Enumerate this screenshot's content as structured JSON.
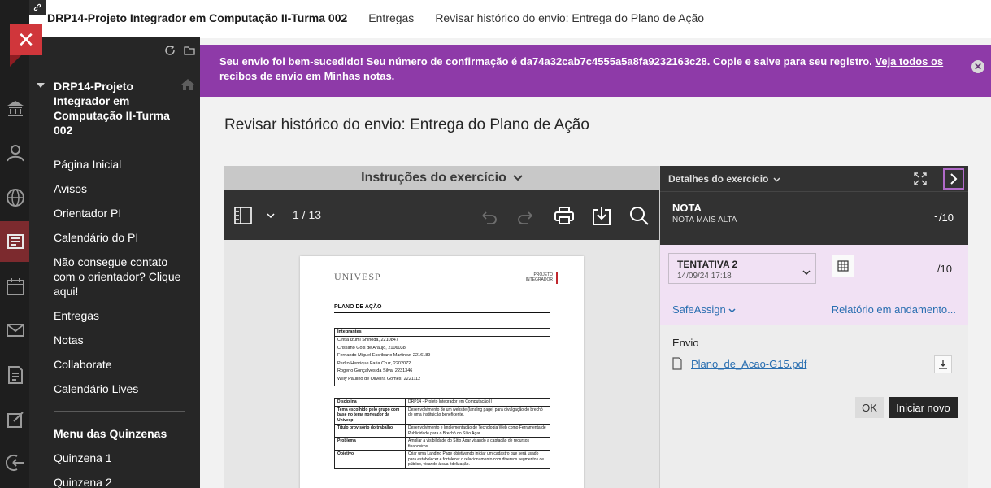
{
  "topbar": {
    "link_icon": "link-icon",
    "crumbs": [
      "DRP14-Projeto Integrador em Computação II-Turma 002",
      "Entregas",
      "Revisar histórico do envio: Entrega do Plano de Ação"
    ]
  },
  "menu": {
    "close_glyph": "✕",
    "course_title": "DRP14-Projeto Integrador em Computação II-Turma 002",
    "items": [
      "Página Inicial",
      "Avisos",
      "Orientador PI",
      "Calendário do PI",
      "Não consegue contato com o orientador? Clique aqui!",
      "Entregas",
      "Notas",
      "Collaborate",
      "Calendário Lives"
    ],
    "submenu_title": "Menu das Quinzenas",
    "submenu_items": [
      "Quinzena 1",
      "Quinzena 2"
    ]
  },
  "banner": {
    "message": "Seu envio foi bem-sucedido! Seu número de confirmação é da74a32cab7c4555a5a8fa9232163c28. Copie e salve para seu registro.",
    "link": "Veja todos os recibos de envio em Minhas notas.",
    "close_glyph": "✕"
  },
  "page": {
    "title": "Revisar histórico do envio: Entrega do Plano de Ação"
  },
  "viewer": {
    "instructions_label": "Instruções do exercício",
    "page_indicator": "1 / 13",
    "doc": {
      "logo": "UNIVESP",
      "tag_line1": "PROJETO",
      "tag_line2": "INTEGRADOR",
      "heading": "PLANO DE AÇÃO",
      "members_header": "Integrantes",
      "members": [
        "Cintia Izumi Shinoda, 2210847",
        "Cristiano Gois de Araujo, 2106038",
        "Fernando Miguel Escribano Martinez, 2216189",
        "Pedro Henrique Faria Cruz, 2202072",
        "Rogerio Gonçalves da Silva, 2231346",
        "Willy Paulino de Oliveira Gomes, 2221112"
      ],
      "rows": [
        {
          "k": "Disciplina",
          "v": "DRP14 - Projeto Integrador em Computação II"
        },
        {
          "k": "Tema escolhido pelo grupo com base no tema norteador da Univesp",
          "v": "Desenvolvimento de um website (landing page) para divulgação do brechó de uma instituição beneficente."
        },
        {
          "k": "Título provisório do trabalho",
          "v": "Desenvolvimento e Implementação de Tecnologia Web como Ferramenta de Publicidade para o Brechó do Sítio Agar"
        },
        {
          "k": "Problema",
          "v": "Ampliar a visibilidade do Sítio Agar visando a captação de recursos financeiros"
        },
        {
          "k": "Objetivo",
          "v": "Criar uma Landing Page objetivando iniciar um cadastro que será usado para estabelecer e fortalecer o relacionamento com diversos segmentos de público, visando à sua fidelização."
        }
      ]
    }
  },
  "panel": {
    "header": "Detalhes do exercício",
    "grade_label": "NOTA",
    "grade_sublabel": "NOTA MAIS ALTA",
    "grade_dash": "-",
    "grade_value": "/10",
    "attempt_name": "TENTATIVA 2",
    "attempt_date": "14/09/24 17:18",
    "attempt_grade": "/10",
    "safeassign": "SafeAssign",
    "report": "Relatório em andamento...",
    "submission_label": "Envio",
    "file_name": "Plano_de_Acao-G15.pdf",
    "ok_label": "OK",
    "start_new_label": "Iniciar novo"
  },
  "colors": {
    "banner": "#8e3aa8",
    "close_button": "#d0363b",
    "link": "#2a6fb1",
    "attempt_bg": "#f1e1f4"
  }
}
